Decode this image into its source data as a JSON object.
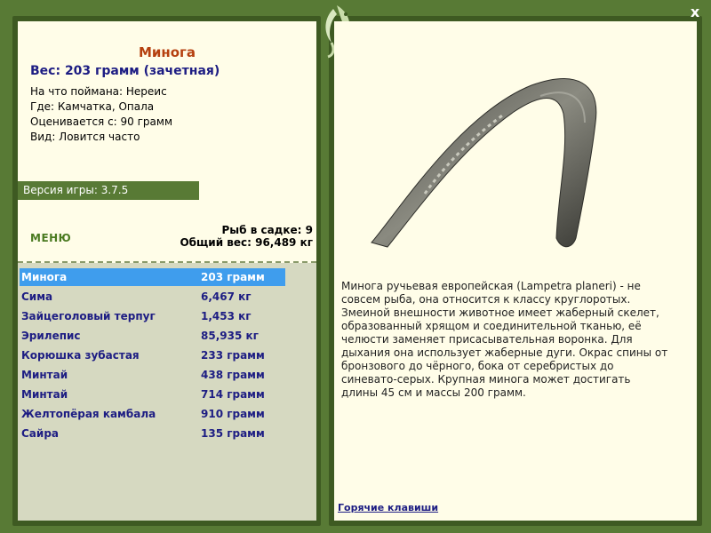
{
  "fish": {
    "name": "Минога",
    "weight_line": "Вес: 203 грамм (зачетная)",
    "bait": "На что поймана: Нереис",
    "location": "Где: Камчатка, Опала",
    "rated_from": "Оценивается с: 90 грамм",
    "frequency": "Вид: Ловится часто",
    "description": "Минога ручьевая европейская (Lampetra planeri) - не совсем рыба, она относится к классу круглоротых. Змеиной внешности животное имеет жаберный скелет, образованный хрящом и соединительной тканью, её челюсти заменяет присасывательная воронка. Для дыхания она использует жаберные дуги. Окрас спины от бронзового до чёрного, бока от серебристых до синевато-серых. Крупная минога может достигать длины 45 см и массы 200 грамм."
  },
  "version": "Версия игры: 3.7.5",
  "menu_label": "МЕНЮ",
  "keepnet": {
    "count_line": "Рыб в садке: 9",
    "total_line": "Общий вес: 96,489 кг"
  },
  "catch_list": [
    {
      "name": "Минога",
      "weight": "203 грамм"
    },
    {
      "name": "Сима",
      "weight": "6,467 кг"
    },
    {
      "name": "Зайцеголовый терпуг",
      "weight": "1,453 кг"
    },
    {
      "name": "Эрилепис",
      "weight": "85,935 кг"
    },
    {
      "name": "Корюшка зубастая",
      "weight": "233 грамм"
    },
    {
      "name": "Минтай",
      "weight": "438 грамм"
    },
    {
      "name": "Минтай",
      "weight": "714 грамм"
    },
    {
      "name": "Желтопёрая камбала",
      "weight": "910 грамм"
    },
    {
      "name": "Сайра",
      "weight": "135 грамм"
    }
  ],
  "hotkeys_label": "Горячие клавиши",
  "close_label": "x",
  "colors": {
    "frame": "#587a35",
    "panel": "#fffde8",
    "title": "#b5400f",
    "text_blue": "#1d1d83",
    "selected": "#3f9ded"
  }
}
